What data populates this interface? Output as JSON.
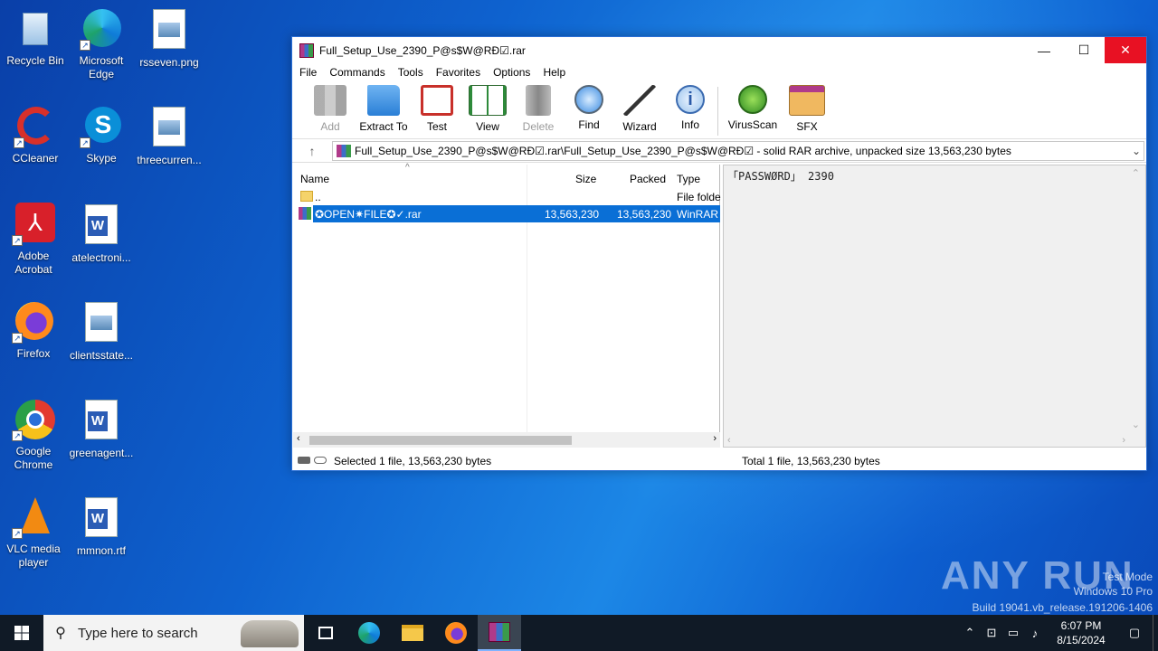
{
  "desktop": {
    "icons": [
      {
        "label": "Recycle Bin",
        "icon": "recycle-bin-icon"
      },
      {
        "label": "Microsoft Edge",
        "icon": "edge-icon"
      },
      {
        "label": "rsseven.png",
        "icon": "image-file-icon"
      },
      {
        "label": "CCleaner",
        "icon": "ccleaner-icon"
      },
      {
        "label": "Skype",
        "icon": "skype-icon"
      },
      {
        "label": "threecurren...",
        "icon": "image-file-icon"
      },
      {
        "label": "Adobe Acrobat",
        "icon": "acrobat-icon"
      },
      {
        "label": "atelectroni...",
        "icon": "word-doc-icon"
      },
      {
        "label": "Firefox",
        "icon": "firefox-icon"
      },
      {
        "label": "clientsstate...",
        "icon": "image-file-icon"
      },
      {
        "label": "Google Chrome",
        "icon": "chrome-icon"
      },
      {
        "label": "greenagent...",
        "icon": "word-doc-icon"
      },
      {
        "label": "VLC media player",
        "icon": "vlc-icon"
      },
      {
        "label": "mmnon.rtf",
        "icon": "word-doc-icon"
      }
    ]
  },
  "window": {
    "title": "Full_Setup_Use_2390_P@s$W@RĐ☑.rar",
    "minimize": "—",
    "maximize": "☐",
    "close": "✕"
  },
  "menu": [
    "File",
    "Commands",
    "Tools",
    "Favorites",
    "Options",
    "Help"
  ],
  "toolbar": [
    {
      "label": "Add",
      "disabled": true
    },
    {
      "label": "Extract To",
      "disabled": false
    },
    {
      "label": "Test",
      "disabled": false
    },
    {
      "label": "View",
      "disabled": false
    },
    {
      "label": "Delete",
      "disabled": true
    },
    {
      "label": "Find",
      "disabled": false
    },
    {
      "label": "Wizard",
      "disabled": false
    },
    {
      "label": "Info",
      "disabled": false
    },
    {
      "label": "VirusScan",
      "disabled": false
    },
    {
      "label": "SFX",
      "disabled": false
    }
  ],
  "path": {
    "text": "Full_Setup_Use_2390_P@s$W@RĐ☑.rar\\Full_Setup_Use_2390_P@s$W@RĐ☑ - solid RAR archive, unpacked size 13,563,230 bytes",
    "up_glyph": "↑",
    "dropdown_glyph": "⌄"
  },
  "file_list": {
    "columns": {
      "name": "Name",
      "size": "Size",
      "packed": "Packed",
      "type": "Type"
    },
    "rows": [
      {
        "name": "..",
        "size": "",
        "packed": "",
        "type": "File folde",
        "selected": false
      },
      {
        "name": "✪OPEN✷FILE✪✓.rar",
        "size": "13,563,230",
        "packed": "13,563,230",
        "type": "WinRAR",
        "selected": true
      }
    ]
  },
  "comment": "「PASSWØRD」 2390",
  "status": {
    "left": "Selected 1 file, 13,563,230 bytes",
    "right": "Total 1 file, 13,563,230 bytes"
  },
  "watermark": {
    "brand": "ANY RUN",
    "line1": "Test Mode",
    "line2": "Windows 10 Pro",
    "line3": "Build 19041.vb_release.191206-1406"
  },
  "taskbar": {
    "search_placeholder": "Type here to search",
    "time": "6:07 PM",
    "date": "8/15/2024"
  }
}
